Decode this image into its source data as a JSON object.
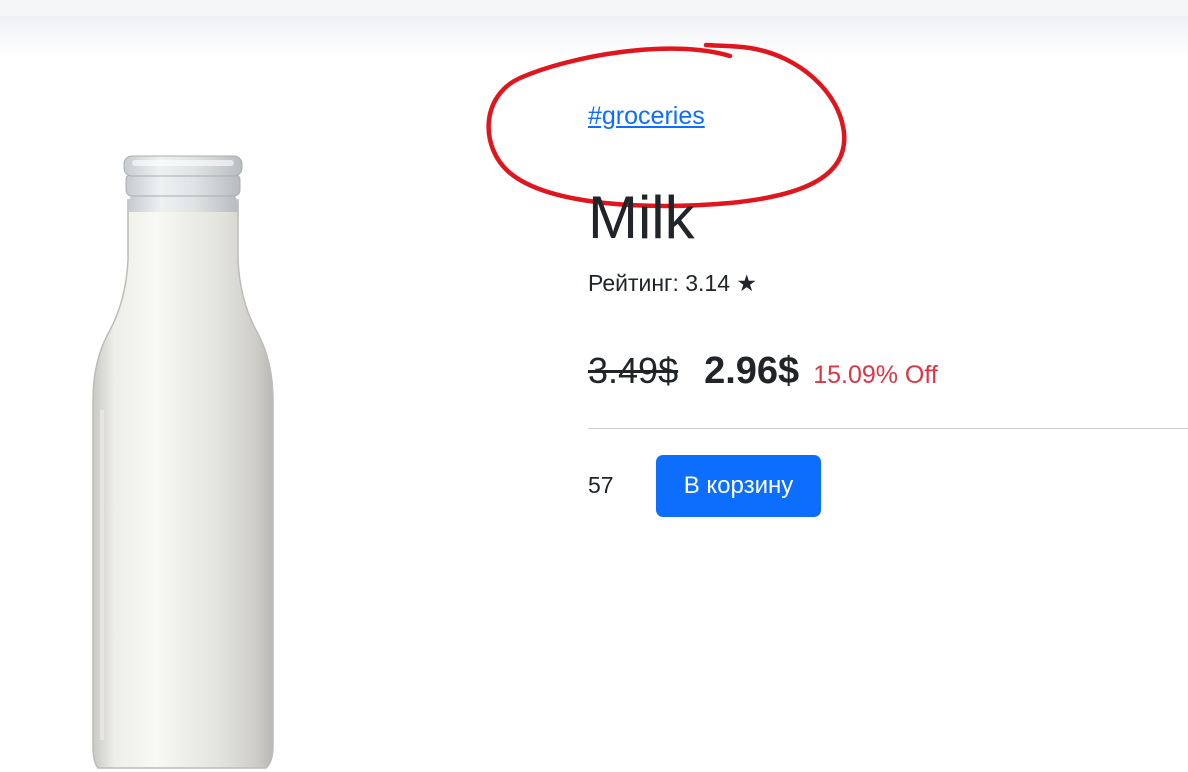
{
  "product": {
    "tag": "#groceries",
    "title": "Milk",
    "rating_label": "Рейтинг: 3.14 ★",
    "old_price": "3.49$",
    "new_price": "2.96$",
    "discount": "15.09% Off",
    "quantity": "57",
    "add_to_cart_label": "В корзину",
    "image": "milk-bottle"
  },
  "annotation": {
    "shape": "hand-drawn-circle",
    "color": "#e0161e"
  },
  "colors": {
    "link": "#0d6efd",
    "button": "#0d6efd",
    "discount": "#dc3545",
    "text": "#212529"
  }
}
